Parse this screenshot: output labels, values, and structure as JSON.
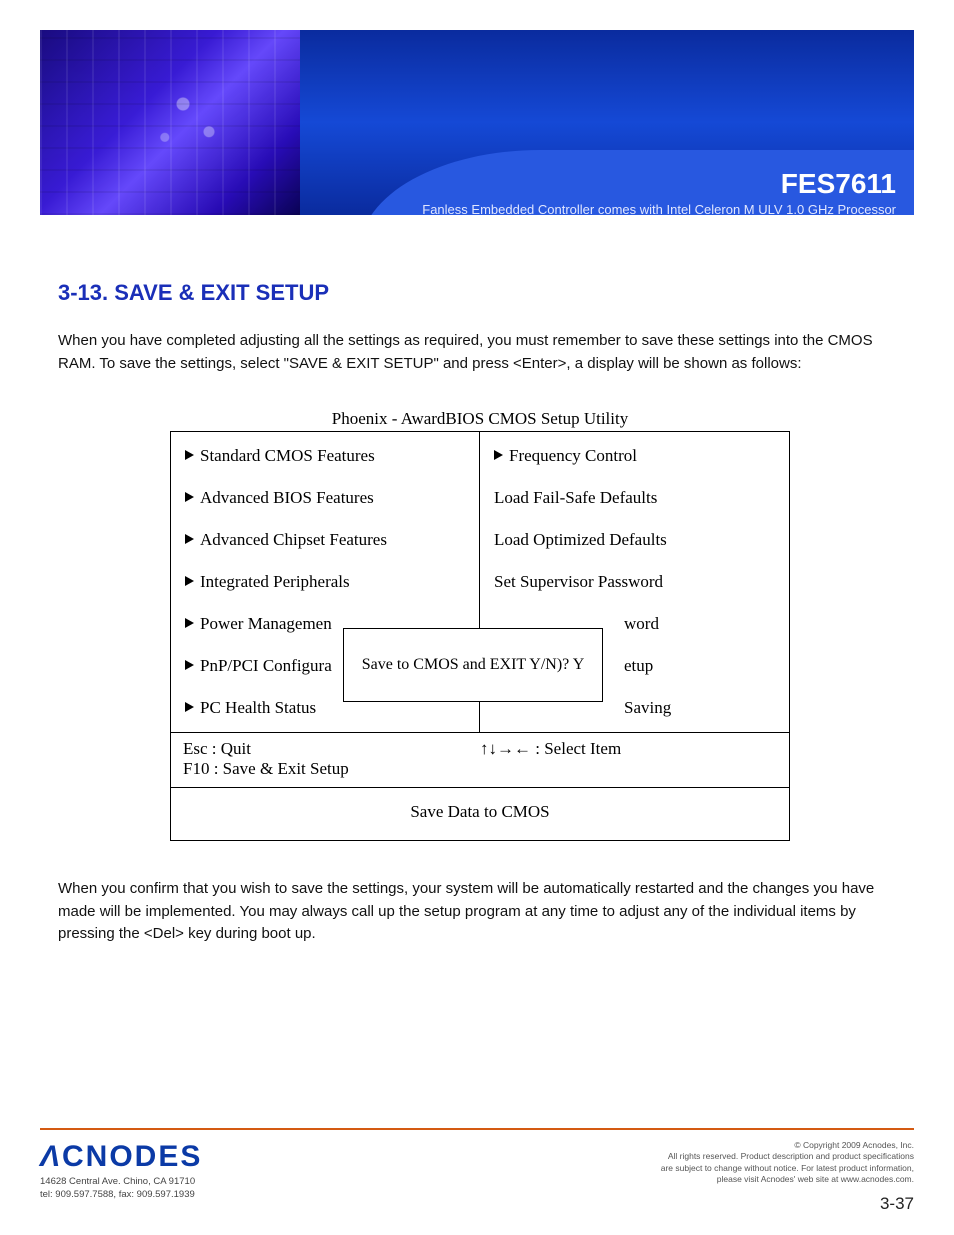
{
  "header": {
    "product": "FES7611",
    "subtitle": "Fanless Embedded Controller comes with Intel Celeron M ULV 1.0 GHz Processor"
  },
  "section_title": "3-13. SAVE & EXIT SETUP",
  "intro": "When you have completed adjusting all the settings as required, you must remember to save these settings into the CMOS RAM. To save the settings, select \"SAVE & EXIT SETUP\" and press <Enter>, a display will be shown as follows:",
  "bios": {
    "caption_line1": "Phoenix - AwardBIOS CMOS Setup Utility",
    "left_items": [
      "Standard CMOS Features",
      "Advanced BIOS Features",
      "Advanced Chipset Features",
      "Integrated Peripherals",
      "Power Managemen",
      "PnP/PCI Configura",
      "PC Health Status"
    ],
    "right_items_tri": [
      "Frequency Control"
    ],
    "right_items_plain": [
      "Load Fail-Safe Defaults",
      "Load Optimized Defaults",
      "Set Supervisor Password",
      "word",
      "etup",
      "Saving"
    ],
    "popup": "Save to CMOS and EXIT Y/N)? Y",
    "mid_left1": "Esc : Quit",
    "mid_left2": "F10 : Save & Exit Setup",
    "mid_right": "↑↓→← : Select Item",
    "bottom": "Save Data to CMOS"
  },
  "outro": "When you confirm that you wish to save the settings, your system will be automatically restarted and the changes you have made will be implemented. You may always call up the setup program at any time to adjust any of the individual items by pressing the <Del> key during boot up.",
  "footer": {
    "logo": "CNODES",
    "addr_line1": "14628 Central Ave. Chino, CA 91710",
    "addr_line2": "tel: 909.597.7588, fax: 909.597.1939",
    "copy_line1": "© Copyright 2009 Acnodes, Inc.",
    "copy_line2": "All rights reserved. Product description and product specifications",
    "copy_line3": "are subject to change without notice. For latest product information,",
    "copy_line4": "please visit Acnodes' web site at www.acnodes.com.",
    "page": "3-37"
  }
}
